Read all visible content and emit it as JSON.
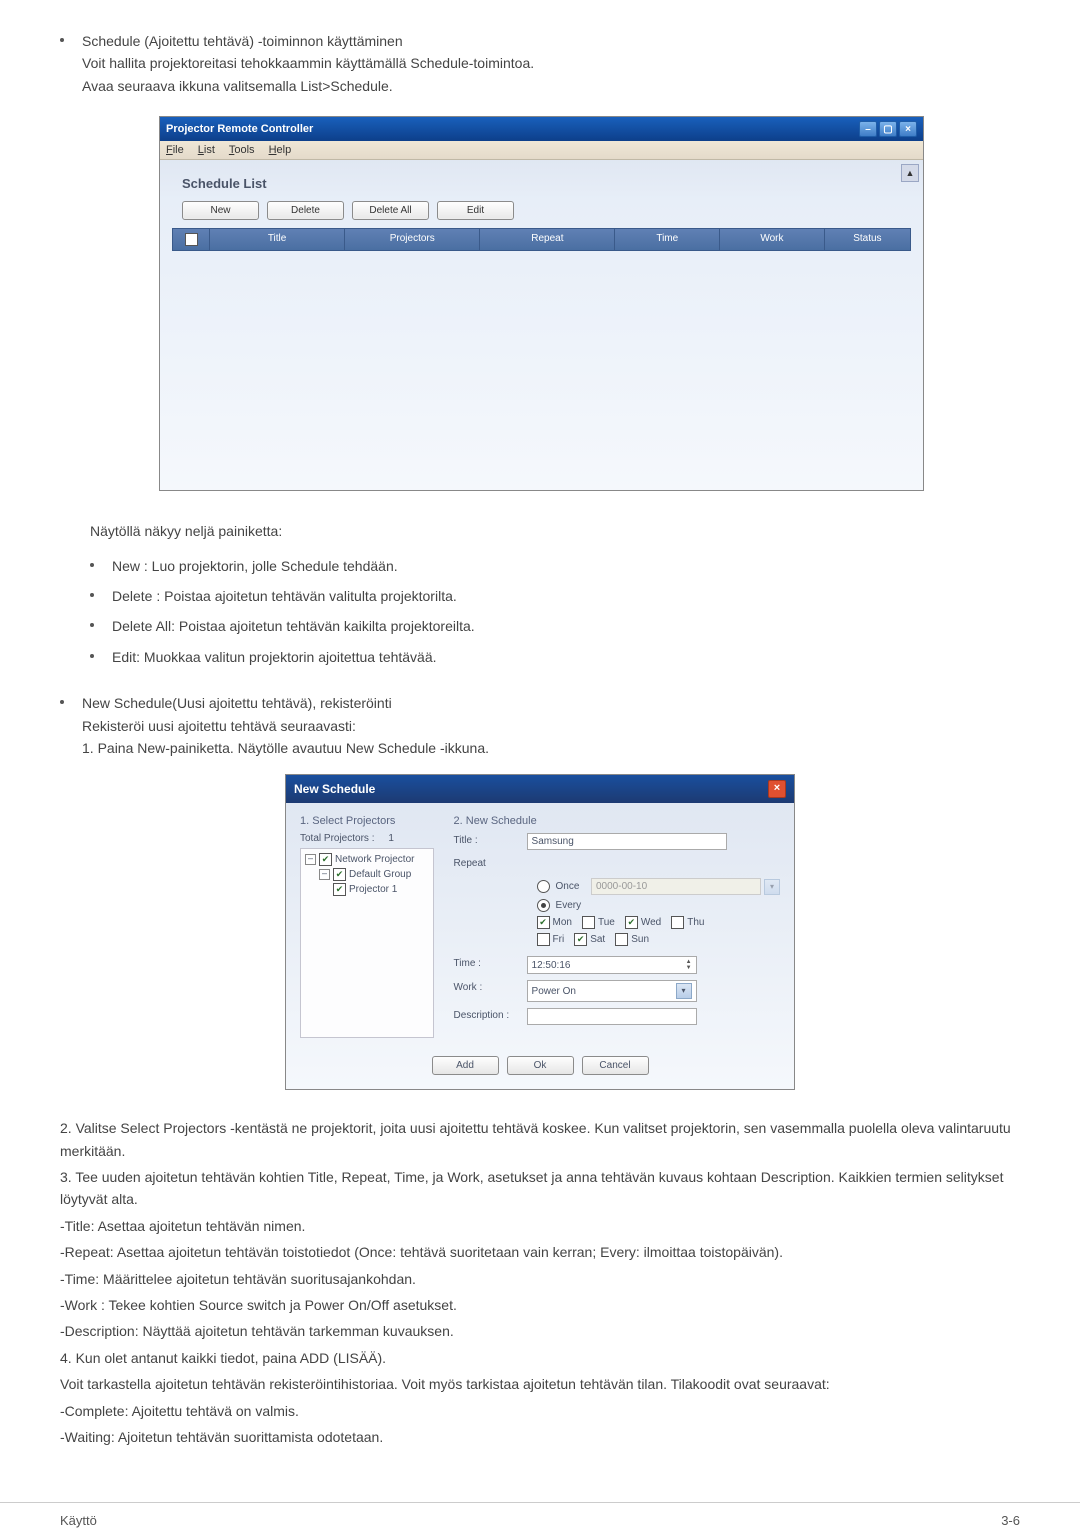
{
  "intro": {
    "line1": "Schedule (Ajoitettu tehtävä) -toiminnon käyttäminen",
    "line2": "Voit hallita projektoreitasi tehokkaammin käyttämällä Schedule-toimintoa.",
    "line3": "Avaa seuraava ikkuna valitsemalla  List>Schedule."
  },
  "window1": {
    "title": "Projector Remote Controller",
    "menu": {
      "file": "File",
      "list": "List",
      "tools": "Tools",
      "help": "Help"
    },
    "section": "Schedule List",
    "buttons": {
      "new": "New",
      "delete": "Delete",
      "deleteAll": "Delete All",
      "edit": "Edit"
    },
    "headers": {
      "title": "Title",
      "projectors": "Projectors",
      "repeat": "Repeat",
      "time": "Time",
      "work": "Work",
      "status": "Status"
    }
  },
  "buttonsDesc": {
    "intro": "Näytöllä näkyy neljä painiketta:",
    "items": [
      " New : Luo projektorin, jolle Schedule tehdään.",
      "Delete : Poistaa ajoitetun tehtävän valitulta projektorilta.",
      "Delete All: Poistaa ajoitetun tehtävän kaikilta projektoreilta.",
      "Edit: Muokkaa valitun projektorin ajoitettua tehtävää."
    ]
  },
  "newSchedule": {
    "title": "New Schedule(Uusi ajoitettu tehtävä), rekisteröinti",
    "line2": "Rekisteröi uusi ajoitettu tehtävä seuraavasti:",
    "line3": "1. Paina New-painiketta. Näytölle avautuu  New Schedule -ikkuna."
  },
  "dialog": {
    "title": "New Schedule",
    "left_header": "1. Select Projectors",
    "total": "Total Projectors :",
    "total_n": "1",
    "tree": {
      "root": "Network Projector",
      "group": "Default Group",
      "proj": "Projector 1"
    },
    "right_header": "2. New Schedule",
    "labels": {
      "titleL": "Title :",
      "repeat": "Repeat",
      "once": "Once",
      "every": "Every",
      "time": "Time :",
      "work": "Work :",
      "desc": "Description :"
    },
    "titleValue": "Samsung",
    "dateValue": "0000-00-10",
    "days": {
      "mon": "Mon",
      "tue": "Tue",
      "wed": "Wed",
      "thu": "Thu",
      "fri": "Fri",
      "sat": "Sat",
      "sun": "Sun"
    },
    "timeValue": "12:50:16",
    "workValue": "Power On",
    "buttons": {
      "add": "Add",
      "ok": "Ok",
      "cancel": "Cancel"
    }
  },
  "paras": {
    "p2": "2. Valitse Select Projectors -kentästä ne projektorit, joita uusi ajoitettu tehtävä koskee. Kun valitset projektorin, sen vasemmalla puolella oleva valintaruutu merkitään.",
    "p3": "3. Tee uuden ajoitetun tehtävän kohtien Title, Repeat, Time, ja Work, asetukset ja anna tehtävän kuvaus kohtaan Description. Kaikkien termien selitykset löytyvät alta.",
    "t1": "-Title: Asettaa ajoitetun tehtävän nimen.",
    "t2": "-Repeat: Asettaa ajoitetun tehtävän toistotiedot (Once: tehtävä suoritetaan vain kerran; Every: ilmoittaa toistopäivän).",
    "t3": "-Time: Määrittelee ajoitetun tehtävän suoritusajankohdan.",
    "t4": "-Work : Tekee kohtien Source switch ja Power On/Off asetukset.",
    "t5": "-Description: Näyttää ajoitetun tehtävän tarkemman kuvauksen.",
    "p4": "4. Kun olet antanut kaikki tiedot, paina ADD (LISÄÄ).",
    "p5": "Voit tarkastella ajoitetun tehtävän rekisteröintihistoriaa. Voit myös tarkistaa ajoitetun tehtävän tilan. Tilakoodit ovat seuraavat:",
    "s1": "-Complete: Ajoitettu tehtävä on valmis.",
    "s2": "-Waiting: Ajoitetun tehtävän suorittamista odotetaan."
  },
  "footer": {
    "left": "Käyttö",
    "right": "3-6"
  }
}
